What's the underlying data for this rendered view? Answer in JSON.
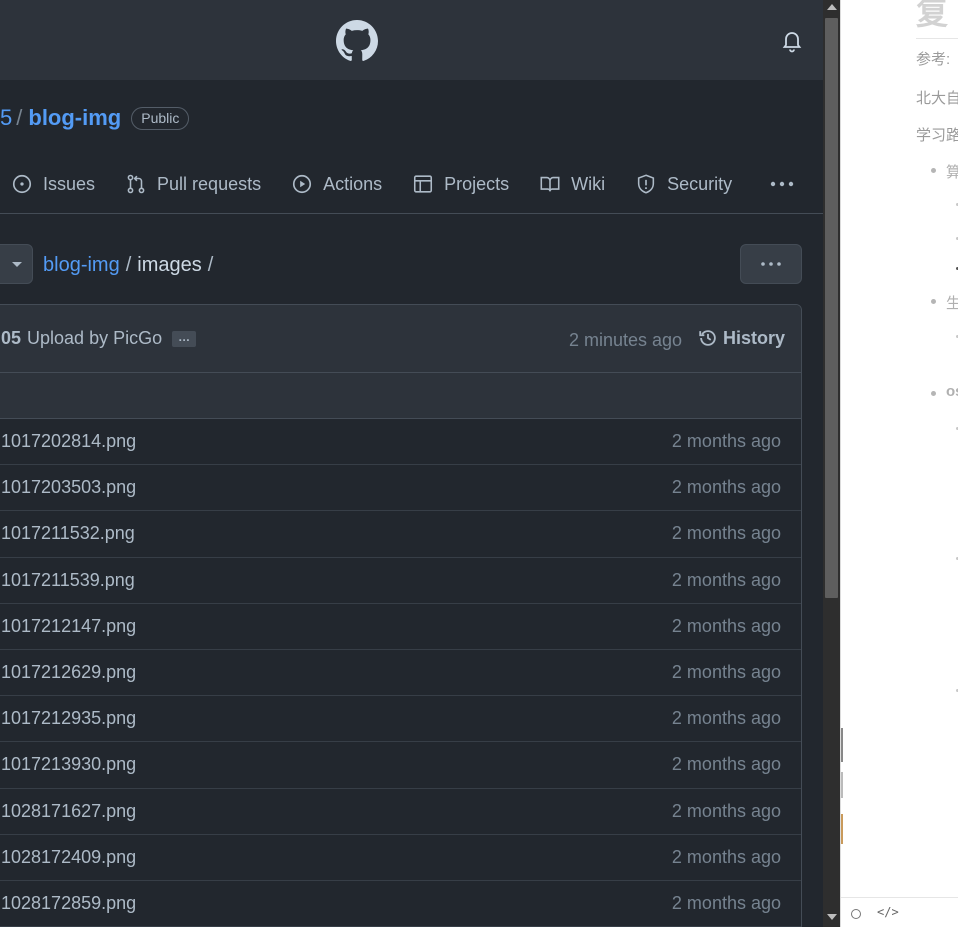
{
  "github": {
    "repo": {
      "owner_tail": "5",
      "separator": "/",
      "name": "blog-img",
      "visibility": "Public"
    },
    "tabs": [
      {
        "label": "Issues",
        "icon": "issue-circle-icon"
      },
      {
        "label": "Pull requests",
        "icon": "pull-request-icon"
      },
      {
        "label": "Actions",
        "icon": "play-circle-icon"
      },
      {
        "label": "Projects",
        "icon": "table-icon"
      },
      {
        "label": "Wiki",
        "icon": "book-icon"
      },
      {
        "label": "Security",
        "icon": "shield-icon"
      }
    ],
    "tabs_more": "···",
    "breadcrumb": {
      "repo": "blog-img",
      "sep1": "/",
      "folder": "images",
      "sep2": "/"
    },
    "more_button": "···",
    "commit": {
      "hash_tail": "05",
      "message": "Upload by PicGo",
      "ellipsis": "…",
      "time": "2 minutes ago",
      "history_label": "History"
    },
    "files": [
      {
        "name": "1017202814.png",
        "time": "2 months ago"
      },
      {
        "name": "1017203503.png",
        "time": "2 months ago"
      },
      {
        "name": "1017211532.png",
        "time": "2 months ago"
      },
      {
        "name": "1017211539.png",
        "time": "2 months ago"
      },
      {
        "name": "1017212147.png",
        "time": "2 months ago"
      },
      {
        "name": "1017212629.png",
        "time": "2 months ago"
      },
      {
        "name": "1017212935.png",
        "time": "2 months ago"
      },
      {
        "name": "1017213930.png",
        "time": "2 months ago"
      },
      {
        "name": "1028171627.png",
        "time": "2 months ago"
      },
      {
        "name": "1028172409.png",
        "time": "2 months ago"
      },
      {
        "name": "1028172859.png",
        "time": "2 months ago"
      }
    ]
  },
  "editor": {
    "title": "复",
    "line1": "参考:",
    "line2": "北大自",
    "line3": "学习路",
    "bullet1": "算",
    "bullet2": "生",
    "bullet3": "os",
    "footer_code": "</>"
  },
  "colors": {
    "bg": "#22272e",
    "header": "#2d333b",
    "link": "#539bf5",
    "text": "#adbac7",
    "muted": "#768390",
    "border": "#444c56"
  }
}
